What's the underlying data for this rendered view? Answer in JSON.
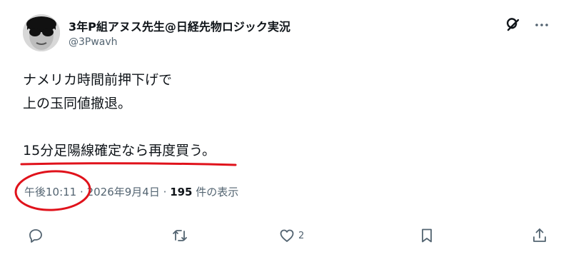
{
  "author": {
    "display_name": "3年P組アヌス先生@日経先物ロジック実況",
    "handle": "@3Pwavh"
  },
  "icons": {
    "avatar": "avatar",
    "grok": "grok-icon",
    "more": "more-icon",
    "reply": "reply-icon",
    "retweet": "retweet-icon",
    "like": "like-icon",
    "bookmark": "bookmark-icon",
    "share": "share-icon"
  },
  "tweet": {
    "lines": [
      "ナメリカ時間前押下げで",
      "上の玉同値撤退。",
      "",
      "15分足陽線確定なら再度買う。"
    ]
  },
  "meta": {
    "time": "午後10:11",
    "separator1": "·",
    "date": "2026年9月4日",
    "separator2": "·",
    "views_count": "195",
    "views_label": "件の表示"
  },
  "actions": {
    "like_count": "2"
  },
  "colors": {
    "text": "#0f1419",
    "secondary": "#536471",
    "annotation_red": "#e0121b"
  }
}
